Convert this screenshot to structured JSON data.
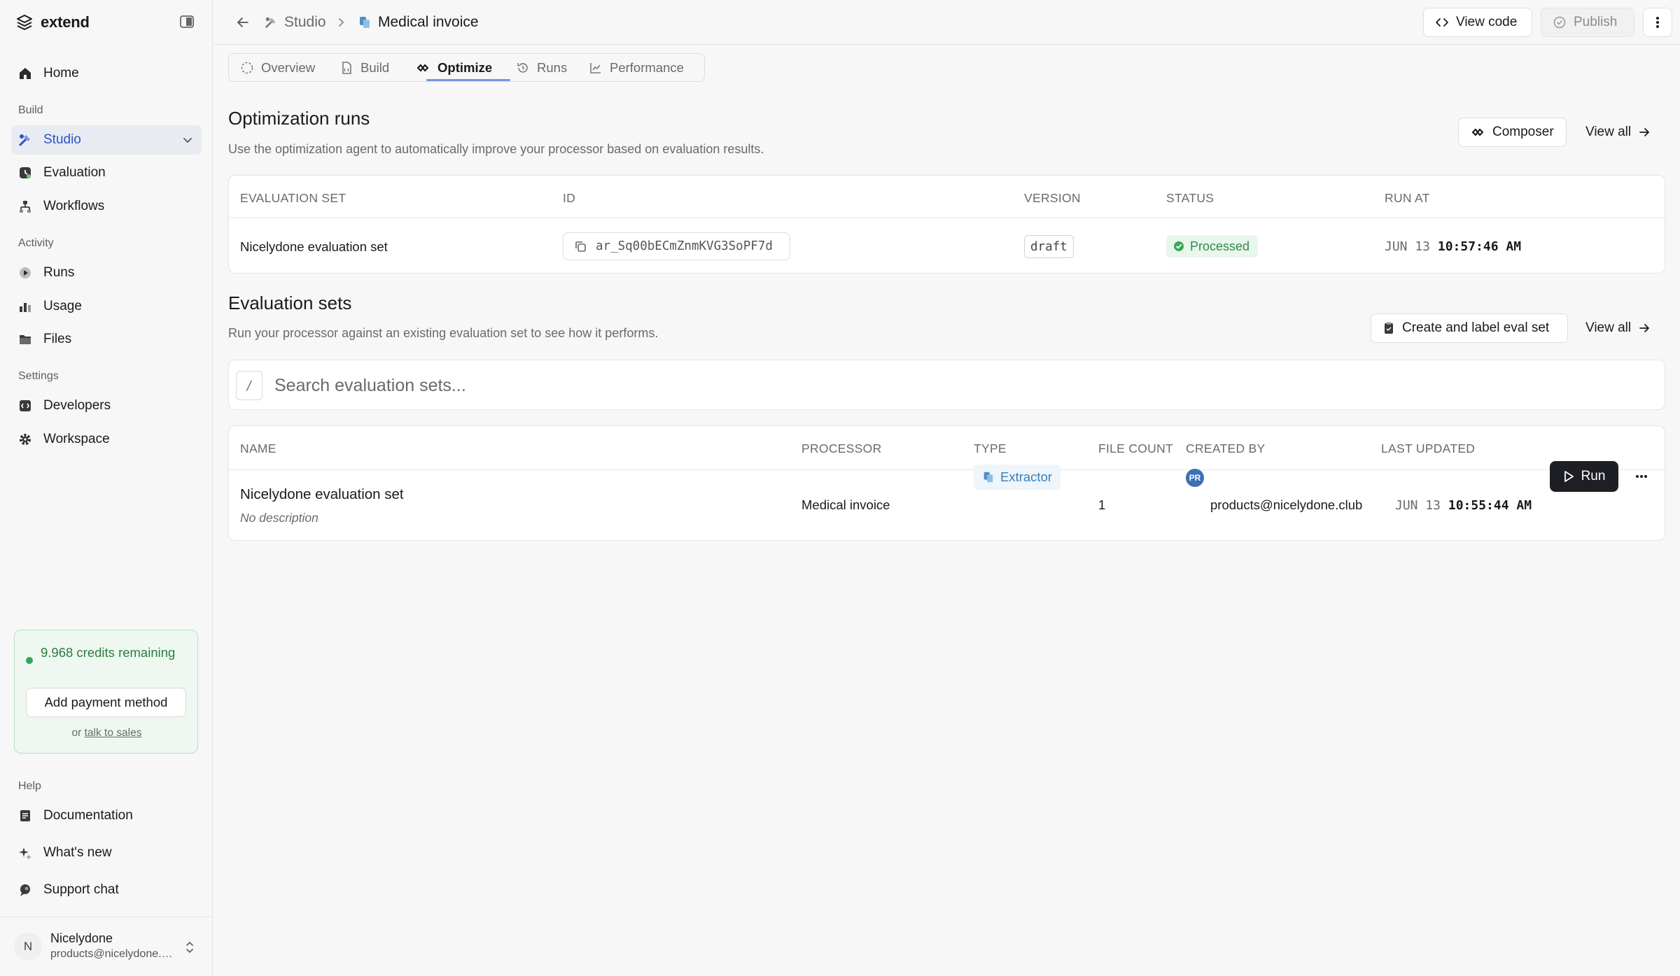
{
  "brand": {
    "name": "extend"
  },
  "sidebar": {
    "home": "Home",
    "sections": {
      "build": "Build",
      "activity": "Activity",
      "settings": "Settings",
      "help": "Help"
    },
    "build_items": [
      "Studio",
      "Evaluation",
      "Workflows"
    ],
    "activity_items": [
      "Runs",
      "Usage",
      "Files"
    ],
    "settings_items": [
      "Developers",
      "Workspace"
    ],
    "help_items": [
      "Documentation",
      "What's new",
      "Support chat"
    ],
    "active_item": "Studio",
    "credits": {
      "text": "9.968 credits remaining",
      "pay_label": "Add payment method",
      "foot_prefix": "or",
      "foot_link": "talk to sales"
    },
    "user": {
      "initial": "N",
      "name": "Nicelydone",
      "email": "products@nicelydone.club"
    }
  },
  "topbar": {
    "breadcrumb": [
      "Studio",
      "Medical invoice"
    ],
    "view_code": "View code",
    "publish": "Publish"
  },
  "tabs": [
    "Overview",
    "Build",
    "Optimize",
    "Runs",
    "Performance"
  ],
  "active_tab": "Optimize",
  "optimization": {
    "title": "Optimization runs",
    "description": "Use the optimization agent to automatically improve your processor based on evaluation results.",
    "composer_label": "Composer",
    "view_all": "View all",
    "columns": [
      "EVALUATION SET",
      "ID",
      "VERSION",
      "STATUS",
      "RUN AT"
    ],
    "row": {
      "evaluation_set": "Nicelydone evaluation set",
      "id": "ar_Sq00bECmZnmKVG3SoPF7d",
      "version": "draft",
      "status": "Processed",
      "run_at_date": "JUN 13",
      "run_at_time": "10:57:46 AM"
    }
  },
  "evaluation_sets": {
    "title": "Evaluation sets",
    "description": "Run your processor against an existing evaluation set to see how it performs.",
    "create_label": "Create and label eval set",
    "view_all": "View all",
    "search": {
      "key": "/",
      "placeholder": "Search evaluation sets..."
    },
    "columns": [
      "NAME",
      "PROCESSOR",
      "TYPE",
      "FILE COUNT",
      "CREATED BY",
      "LAST UPDATED"
    ],
    "row": {
      "name": "Nicelydone evaluation set",
      "description": "No description",
      "processor": "Medical invoice",
      "type": "Extractor",
      "file_count": "1",
      "created_by_initials": "PR",
      "created_by": "products@nicelydone.club",
      "updated_date": "JUN 13",
      "updated_time": "10:55:44 AM",
      "run_label": "Run"
    }
  },
  "colors": {
    "accent": "#2e52c8",
    "active_bg": "#e8ebf1",
    "success": "#2e8c47",
    "credits_bg": "#eef8f0",
    "type_blue": "#3a7fb8",
    "run_button": "#1d1f24"
  },
  "icons": {
    "brand": "extend-logo-icon",
    "collapse": "sidebar-toggle-icon",
    "home": "home-icon",
    "studio": "studio-tools-icon",
    "evaluation": "evaluation-icon",
    "workflows": "workflow-icon",
    "runs": "play-circle-icon",
    "usage": "bar-chart-icon",
    "files": "folder-icon",
    "developers": "developer-icon",
    "workspace": "gear-icon",
    "documentation": "document-icon",
    "whats_new": "sparkle-icon",
    "support": "chat-icon",
    "back": "arrow-left-icon",
    "copy": "copy-icon",
    "check": "check-circle-icon",
    "run": "play-icon",
    "more": "ellipsis-icon"
  }
}
